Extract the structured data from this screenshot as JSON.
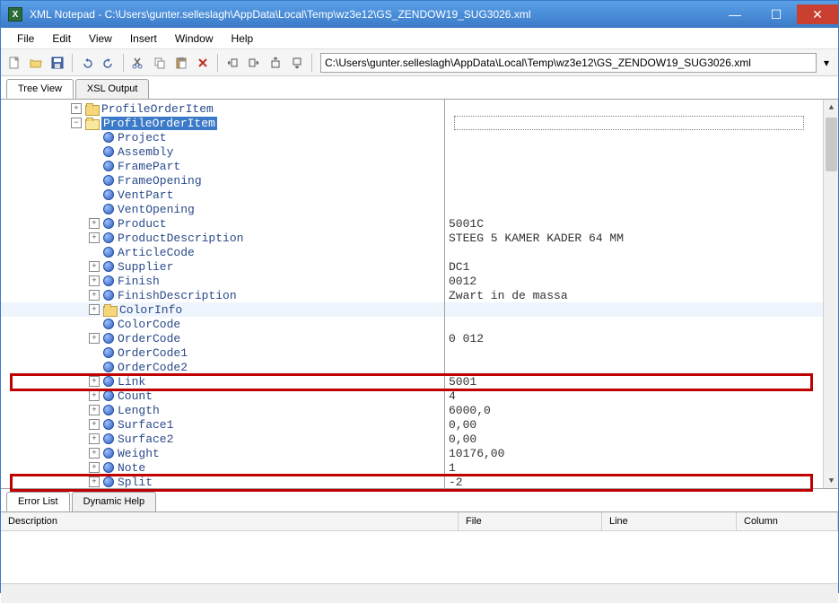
{
  "window": {
    "title": "XML Notepad - C:\\Users\\gunter.selleslagh\\AppData\\Local\\Temp\\wz3e12\\GS_ZENDOW19_SUG3026.xml",
    "app_icon_letter": "X"
  },
  "menu": {
    "file": "File",
    "edit": "Edit",
    "view": "View",
    "insert": "Insert",
    "window": "Window",
    "help": "Help"
  },
  "toolbar": {
    "path": "C:\\Users\\gunter.selleslagh\\AppData\\Local\\Temp\\wz3e12\\GS_ZENDOW19_SUG3026.xml"
  },
  "top_tabs": {
    "tree_view": "Tree View",
    "xsl_output": "XSL Output"
  },
  "tree": {
    "root1": "ProfileOrderItem",
    "root2": "ProfileOrderItem",
    "nodes": {
      "project": "Project",
      "assembly": "Assembly",
      "framepart": "FramePart",
      "frameopening": "FrameOpening",
      "ventpart": "VentPart",
      "ventopening": "VentOpening",
      "product": "Product",
      "productdescription": "ProductDescription",
      "articlecode": "ArticleCode",
      "supplier": "Supplier",
      "finish": "Finish",
      "finishdescription": "FinishDescription",
      "colorinfo": "ColorInfo",
      "colorcode": "ColorCode",
      "ordercode": "OrderCode",
      "ordercode1": "OrderCode1",
      "ordercode2": "OrderCode2",
      "link": "Link",
      "count": "Count",
      "length": "Length",
      "surface1": "Surface1",
      "surface2": "Surface2",
      "weight": "Weight",
      "note": "Note",
      "split": "Split"
    }
  },
  "values": {
    "product": "5001C",
    "productdescription": "STEEG 5 KAMER KADER 64 MM",
    "supplier": "DC1",
    "finish": "0012",
    "finishdescription": "Zwart in de massa",
    "ordercode": "0 012",
    "link": "5001",
    "count": "4",
    "length": "6000,0",
    "surface1": "0,00",
    "surface2": "0,00",
    "weight": "10176,00",
    "note": "1",
    "split": "-2"
  },
  "bottom_tabs": {
    "error_list": "Error List",
    "dynamic_help": "Dynamic Help"
  },
  "error_columns": {
    "description": "Description",
    "file": "File",
    "line": "Line",
    "column": "Column"
  },
  "win_buttons": {
    "min": "—",
    "max": "☐",
    "close": "✕"
  }
}
